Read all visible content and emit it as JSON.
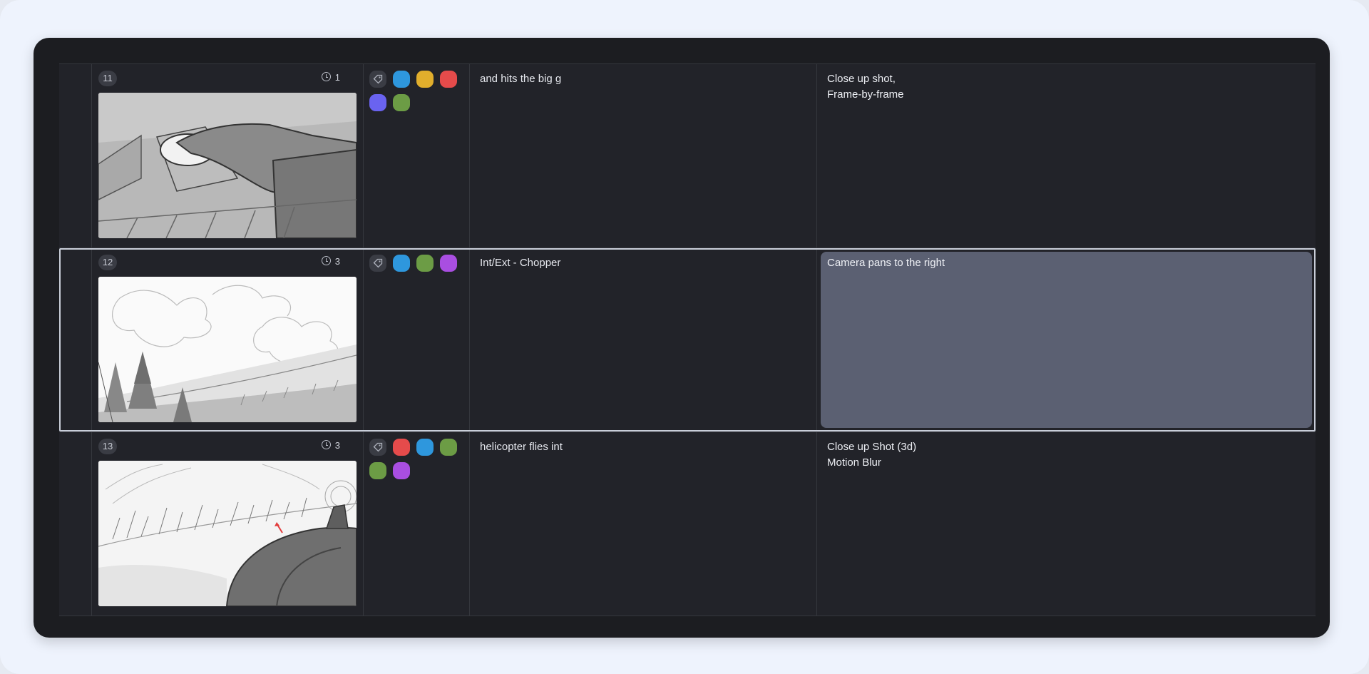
{
  "rows": [
    {
      "number": "11",
      "duration": "1",
      "action": "and hits the big g",
      "notes": [
        "Close up shot,",
        "Frame-by-frame"
      ],
      "tags": [
        "#2e97dd",
        "#e1ae2c",
        "#e54b4b",
        "#6a63f0",
        "#6c9c45"
      ],
      "selected": false
    },
    {
      "number": "12",
      "duration": "3",
      "action": "Int/Ext - Chopper",
      "notes": [
        "Camera pans to the right"
      ],
      "tags": [
        "#2e97dd",
        "#6c9c45",
        "#a94ee1"
      ],
      "selected": true
    },
    {
      "number": "13",
      "duration": "3",
      "action": "helicopter flies int",
      "notes": [
        "Close up Shot (3d)",
        "Motion Blur"
      ],
      "tags": [
        "#e54b4b",
        "#2e97dd",
        "#6c9c45",
        "#6c9c45",
        "#a94ee1"
      ],
      "selected": false
    }
  ],
  "icons": {
    "tag": "tag-icon",
    "clock": "clock-icon"
  }
}
